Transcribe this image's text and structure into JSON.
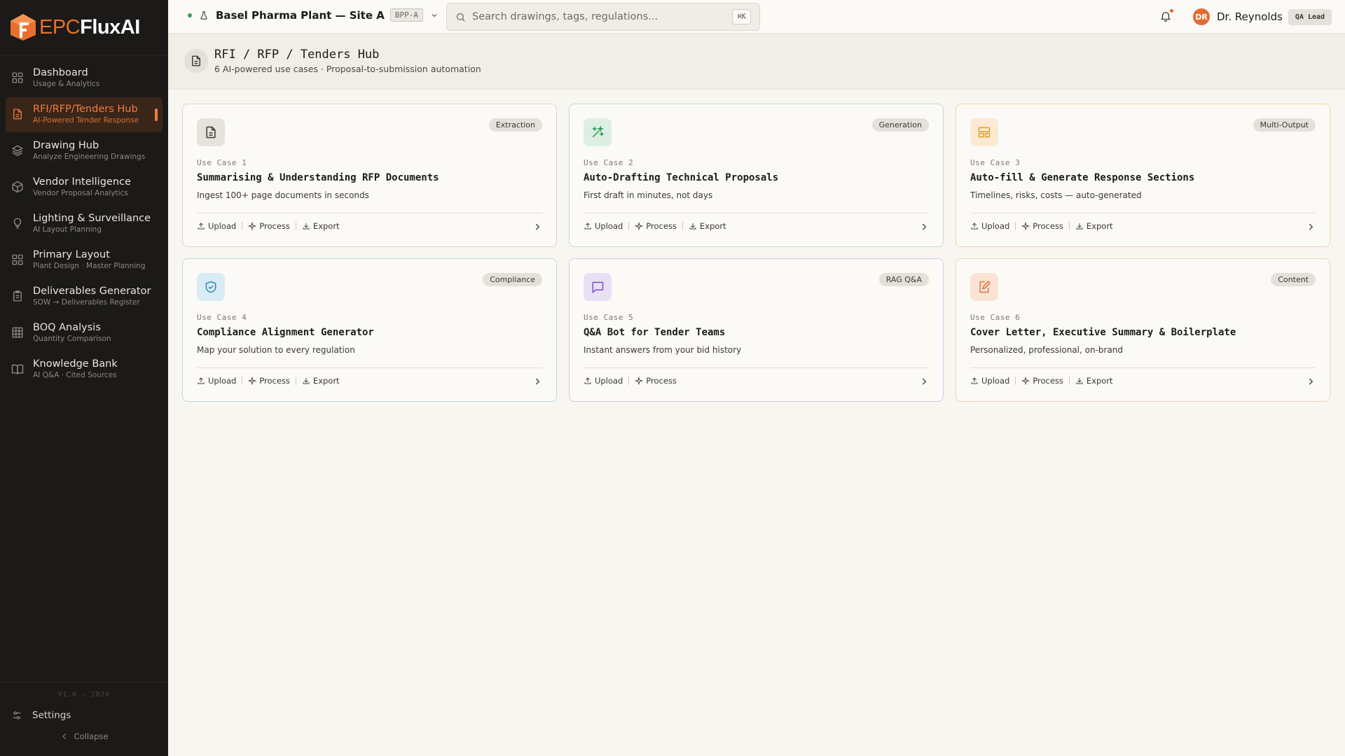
{
  "brand": {
    "part1": "EPC",
    "part2": "FluxAI"
  },
  "sidebar": {
    "items": [
      {
        "label": "Dashboard",
        "sub": "Usage & Analytics",
        "icon": "grid-icon",
        "active": false
      },
      {
        "label": "RFI/RFP/Tenders Hub",
        "sub": "AI-Powered Tender Response",
        "icon": "document-icon",
        "active": true
      },
      {
        "label": "Drawing Hub",
        "sub": "Analyze Engineering Drawings",
        "icon": "layers-icon",
        "active": false
      },
      {
        "label": "Vendor Intelligence",
        "sub": "Vendor Proposal Analytics",
        "icon": "cube-icon",
        "active": false
      },
      {
        "label": "Lighting & Surveillance",
        "sub": "AI Layout Planning",
        "icon": "lightbulb-icon",
        "active": false
      },
      {
        "label": "Primary Layout",
        "sub": "Plant Design · Master Planning",
        "icon": "grid-icon",
        "active": false
      },
      {
        "label": "Deliverables Generator",
        "sub": "SOW → Deliverables Register",
        "icon": "clipboard-icon",
        "active": false
      },
      {
        "label": "BOQ Analysis",
        "sub": "Quantity Comparison",
        "icon": "table-icon",
        "active": false
      },
      {
        "label": "Knowledge Bank",
        "sub": "AI Q&A · Cited Sources",
        "icon": "book-icon",
        "active": false
      }
    ],
    "version": "V1.0 — 2026",
    "settings_label": "Settings",
    "collapse_label": "Collapse"
  },
  "topbar": {
    "site_name": "Basel Pharma Plant — Site A",
    "site_code": "BPP-A",
    "search_placeholder": "Search drawings, tags, regulations...",
    "search_shortcut": "⌘K",
    "user_initials": "DR",
    "user_name": "Dr. Reynolds",
    "user_role": "QA Lead"
  },
  "page": {
    "title": "RFI / RFP / Tenders Hub",
    "subtitle": "6 AI-powered use cases · Proposal-to-submission automation"
  },
  "cards": [
    {
      "badge": "Extraction",
      "use_case": "Use Case 1",
      "title": "Summarising & Understanding RFP Documents",
      "desc": "Ingest 100+ page documents in seconds",
      "actions": [
        "Upload",
        "Process",
        "Export"
      ]
    },
    {
      "badge": "Generation",
      "use_case": "Use Case 2",
      "title": "Auto-Drafting Technical Proposals",
      "desc": "First draft in minutes, not days",
      "actions": [
        "Upload",
        "Process",
        "Export"
      ]
    },
    {
      "badge": "Multi-Output",
      "use_case": "Use Case 3",
      "title": "Auto-fill & Generate Response Sections",
      "desc": "Timelines, risks, costs — auto-generated",
      "actions": [
        "Upload",
        "Process",
        "Export"
      ]
    },
    {
      "badge": "Compliance",
      "use_case": "Use Case 4",
      "title": "Compliance Alignment Generator",
      "desc": "Map your solution to every regulation",
      "actions": [
        "Upload",
        "Process",
        "Export"
      ]
    },
    {
      "badge": "RAG Q&A",
      "use_case": "Use Case 5",
      "title": "Q&A Bot for Tender Teams",
      "desc": "Instant answers from your bid history",
      "actions": [
        "Upload",
        "Process"
      ]
    },
    {
      "badge": "Content",
      "use_case": "Use Case 6",
      "title": "Cover Letter, Executive Summary & Boilerplate",
      "desc": "Personalized, professional, on-brand",
      "actions": [
        "Upload",
        "Process",
        "Export"
      ]
    }
  ]
}
